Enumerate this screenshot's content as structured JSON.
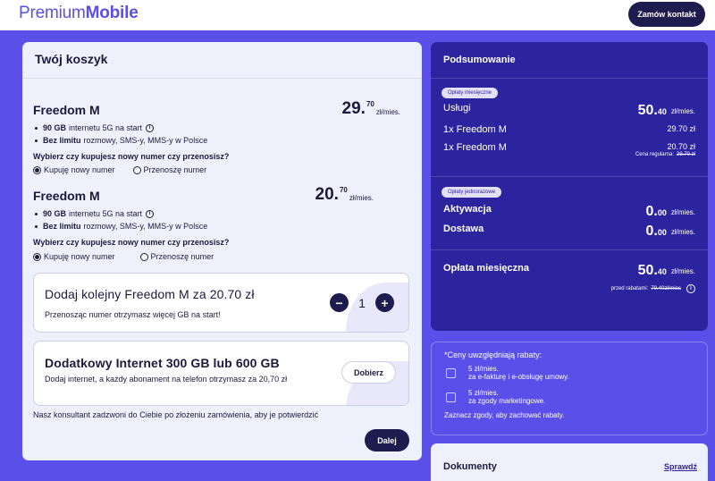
{
  "header": {
    "logo_prefix": "Premium",
    "logo_suffix": "Mobile",
    "contact_button": "Zamów kontakt"
  },
  "cart": {
    "title": "Twój koszyk",
    "plans": [
      {
        "name": "Freedom M",
        "price_int": "29.",
        "price_dec": "70",
        "price_unit": "zł/mies.",
        "feature1_bold": "90 GB",
        "feature1_rest": "internetu 5G na start",
        "feature2_bold": "Bez limitu",
        "feature2_rest": "rozmowy, SMS-y, MMS-y w Polsce",
        "question": "Wybierz czy kupujesz nowy numer czy przenosisz?",
        "option_new": "Kupuję nowy numer",
        "option_port": "Przenoszę numer",
        "selected": "new"
      },
      {
        "name": "Freedom M",
        "price_int": "20.",
        "price_dec": "70",
        "price_unit": "zł/mies.",
        "feature1_bold": "90 GB",
        "feature1_rest": "internetu 5G na start",
        "feature2_bold": "Bez limitu",
        "feature2_rest": "rozmowy, SMS-y, MMS-y w Polsce",
        "question": "Wybierz czy kupujesz nowy numer czy przenosisz?",
        "option_new": "Kupuję nowy numer",
        "option_port": "Przenoszę numer",
        "selected": "new"
      }
    ],
    "addon": {
      "title": "Dodaj kolejny Freedom M za 20.70 zł",
      "subtitle": "Przenosząc numer otrzymasz więcej GB na start!",
      "minus": "−",
      "quantity": "1",
      "plus": "+"
    },
    "internet": {
      "title": "Dodatkowy Internet 300 GB lub 600 GB",
      "subtitle": "Dodaj internet, a każdy abonament na telefon otrzymasz za 20,70 zł",
      "button": "Dobierz"
    },
    "consultant_note": "Nasz konsultant zadzwoni do Ciebie po złożeniu zamówienia, aby je potwierdzić",
    "next_button": "Dalej"
  },
  "summary": {
    "title": "Podsumowanie",
    "monthly_pill": "Opłaty miesięczne",
    "services_label": "Usługi",
    "services_int": "50.",
    "services_dec": "40",
    "unit": "zł/mies.",
    "line1_label": "1x Freedom M",
    "line1_value": "29.70 zł",
    "line2_label": "1x Freedom M",
    "line2_value": "20.70 zł",
    "regular_price_label": "Cena regularna:",
    "regular_price_value": "29.70 zł",
    "onetime_pill": "Opłaty jednorazowe",
    "activation_label": "Aktywacja",
    "activation_int": "0.",
    "activation_dec": "00",
    "delivery_label": "Dostawa",
    "delivery_int": "0.",
    "delivery_dec": "00",
    "total_label": "Opłata miesięczna",
    "total_int": "50.",
    "total_dec": "40",
    "before_discount_label": "przed rabatami:",
    "before_discount_value": "79.40zł/mies"
  },
  "discounts": {
    "heading": "*Ceny uwzględniają rabaty:",
    "item1_amount": "5 zł/mies.",
    "item1_text": "za e-fakturę i e-obsługę umowy.",
    "item2_amount": "5 zł/mies.",
    "item2_text": "za zgody marketingowe.",
    "footer": "Zaznacz zgody, aby zachować rabaty."
  },
  "documents": {
    "title": "Dokumenty",
    "link": "Sprawdź"
  },
  "colors": {
    "brand": "#5a4fe8",
    "navy": "#1e1b4e",
    "summary_bg": "#2c249e"
  }
}
